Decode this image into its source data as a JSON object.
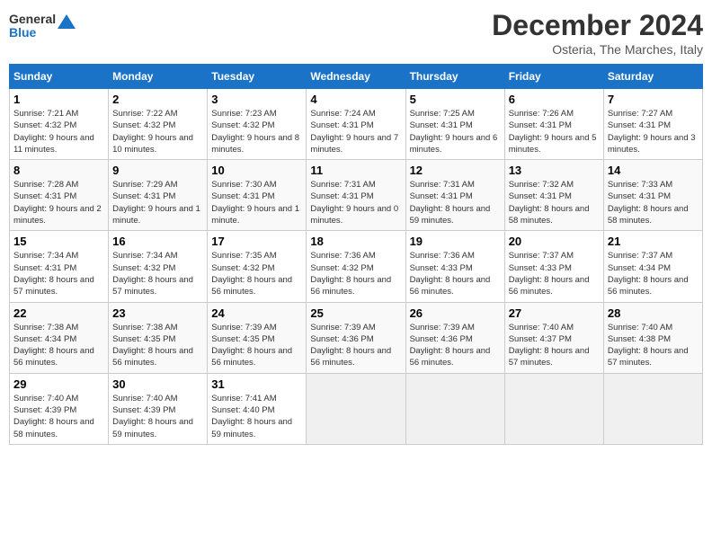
{
  "logo": {
    "line1": "General",
    "line2": "Blue"
  },
  "title": "December 2024",
  "subtitle": "Osteria, The Marches, Italy",
  "days_of_week": [
    "Sunday",
    "Monday",
    "Tuesday",
    "Wednesday",
    "Thursday",
    "Friday",
    "Saturday"
  ],
  "weeks": [
    [
      {
        "day": "1",
        "sunrise": "7:21 AM",
        "sunset": "4:32 PM",
        "daylight": "9 hours and 11 minutes."
      },
      {
        "day": "2",
        "sunrise": "7:22 AM",
        "sunset": "4:32 PM",
        "daylight": "9 hours and 10 minutes."
      },
      {
        "day": "3",
        "sunrise": "7:23 AM",
        "sunset": "4:32 PM",
        "daylight": "9 hours and 8 minutes."
      },
      {
        "day": "4",
        "sunrise": "7:24 AM",
        "sunset": "4:31 PM",
        "daylight": "9 hours and 7 minutes."
      },
      {
        "day": "5",
        "sunrise": "7:25 AM",
        "sunset": "4:31 PM",
        "daylight": "9 hours and 6 minutes."
      },
      {
        "day": "6",
        "sunrise": "7:26 AM",
        "sunset": "4:31 PM",
        "daylight": "9 hours and 5 minutes."
      },
      {
        "day": "7",
        "sunrise": "7:27 AM",
        "sunset": "4:31 PM",
        "daylight": "9 hours and 3 minutes."
      }
    ],
    [
      {
        "day": "8",
        "sunrise": "7:28 AM",
        "sunset": "4:31 PM",
        "daylight": "9 hours and 2 minutes."
      },
      {
        "day": "9",
        "sunrise": "7:29 AM",
        "sunset": "4:31 PM",
        "daylight": "9 hours and 1 minute."
      },
      {
        "day": "10",
        "sunrise": "7:30 AM",
        "sunset": "4:31 PM",
        "daylight": "9 hours and 1 minute."
      },
      {
        "day": "11",
        "sunrise": "7:31 AM",
        "sunset": "4:31 PM",
        "daylight": "9 hours and 0 minutes."
      },
      {
        "day": "12",
        "sunrise": "7:31 AM",
        "sunset": "4:31 PM",
        "daylight": "8 hours and 59 minutes."
      },
      {
        "day": "13",
        "sunrise": "7:32 AM",
        "sunset": "4:31 PM",
        "daylight": "8 hours and 58 minutes."
      },
      {
        "day": "14",
        "sunrise": "7:33 AM",
        "sunset": "4:31 PM",
        "daylight": "8 hours and 58 minutes."
      }
    ],
    [
      {
        "day": "15",
        "sunrise": "7:34 AM",
        "sunset": "4:31 PM",
        "daylight": "8 hours and 57 minutes."
      },
      {
        "day": "16",
        "sunrise": "7:34 AM",
        "sunset": "4:32 PM",
        "daylight": "8 hours and 57 minutes."
      },
      {
        "day": "17",
        "sunrise": "7:35 AM",
        "sunset": "4:32 PM",
        "daylight": "8 hours and 56 minutes."
      },
      {
        "day": "18",
        "sunrise": "7:36 AM",
        "sunset": "4:32 PM",
        "daylight": "8 hours and 56 minutes."
      },
      {
        "day": "19",
        "sunrise": "7:36 AM",
        "sunset": "4:33 PM",
        "daylight": "8 hours and 56 minutes."
      },
      {
        "day": "20",
        "sunrise": "7:37 AM",
        "sunset": "4:33 PM",
        "daylight": "8 hours and 56 minutes."
      },
      {
        "day": "21",
        "sunrise": "7:37 AM",
        "sunset": "4:34 PM",
        "daylight": "8 hours and 56 minutes."
      }
    ],
    [
      {
        "day": "22",
        "sunrise": "7:38 AM",
        "sunset": "4:34 PM",
        "daylight": "8 hours and 56 minutes."
      },
      {
        "day": "23",
        "sunrise": "7:38 AM",
        "sunset": "4:35 PM",
        "daylight": "8 hours and 56 minutes."
      },
      {
        "day": "24",
        "sunrise": "7:39 AM",
        "sunset": "4:35 PM",
        "daylight": "8 hours and 56 minutes."
      },
      {
        "day": "25",
        "sunrise": "7:39 AM",
        "sunset": "4:36 PM",
        "daylight": "8 hours and 56 minutes."
      },
      {
        "day": "26",
        "sunrise": "7:39 AM",
        "sunset": "4:36 PM",
        "daylight": "8 hours and 56 minutes."
      },
      {
        "day": "27",
        "sunrise": "7:40 AM",
        "sunset": "4:37 PM",
        "daylight": "8 hours and 57 minutes."
      },
      {
        "day": "28",
        "sunrise": "7:40 AM",
        "sunset": "4:38 PM",
        "daylight": "8 hours and 57 minutes."
      }
    ],
    [
      {
        "day": "29",
        "sunrise": "7:40 AM",
        "sunset": "4:39 PM",
        "daylight": "8 hours and 58 minutes."
      },
      {
        "day": "30",
        "sunrise": "7:40 AM",
        "sunset": "4:39 PM",
        "daylight": "8 hours and 59 minutes."
      },
      {
        "day": "31",
        "sunrise": "7:41 AM",
        "sunset": "4:40 PM",
        "daylight": "8 hours and 59 minutes."
      },
      null,
      null,
      null,
      null
    ]
  ],
  "labels": {
    "sunrise": "Sunrise:",
    "sunset": "Sunset:",
    "daylight": "Daylight:"
  }
}
